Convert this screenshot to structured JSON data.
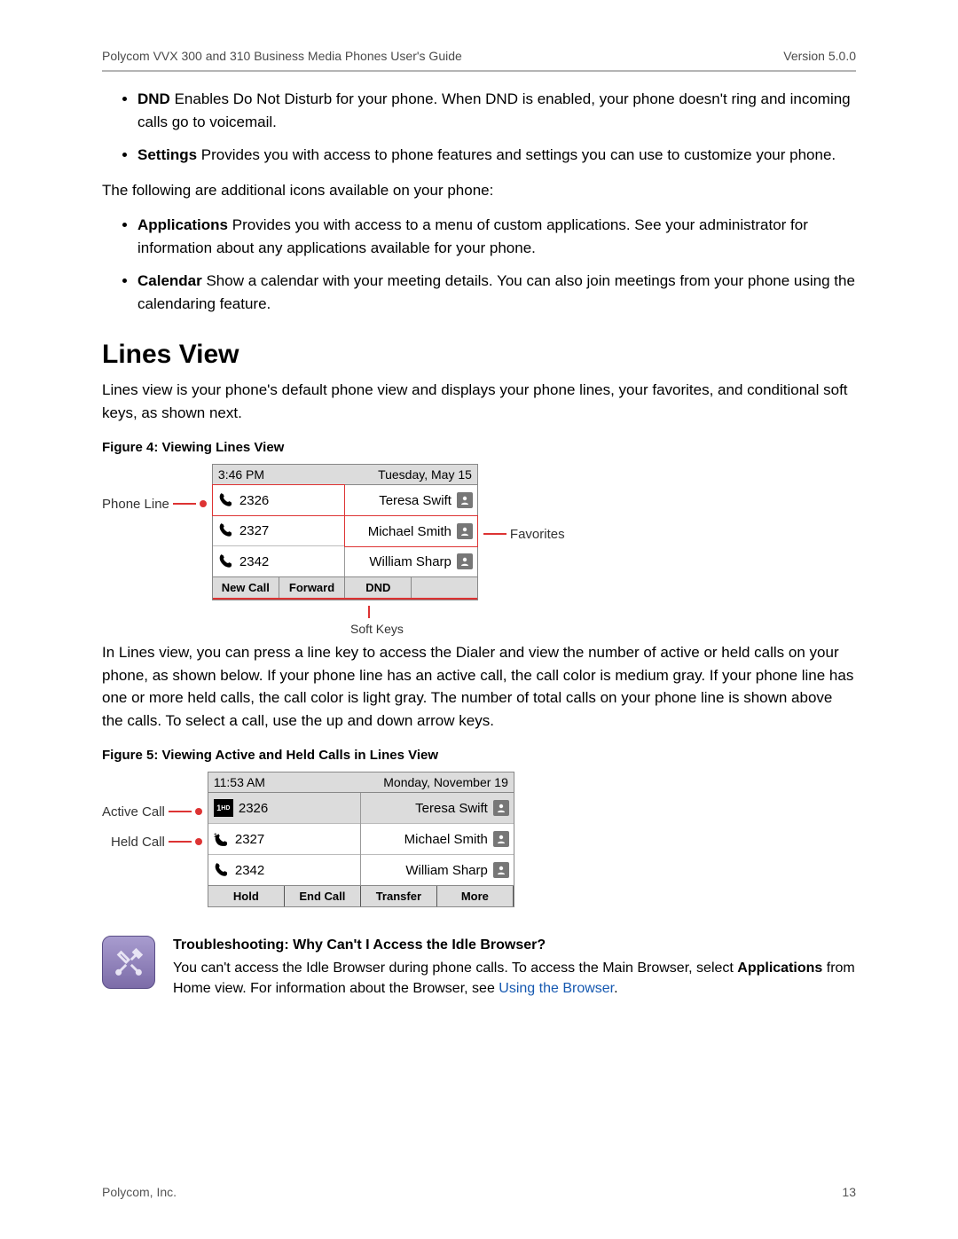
{
  "header": {
    "doc_title": "Polycom VVX 300 and 310 Business Media Phones User's Guide",
    "version": "Version 5.0.0"
  },
  "intro_bullets": [
    {
      "term": "DND",
      "desc": "   Enables Do Not Disturb for your phone. When DND is enabled, your phone doesn't ring and incoming calls go to voicemail."
    },
    {
      "term": "Settings",
      "desc": "   Provides you with access to phone features and settings you can use to customize your phone."
    }
  ],
  "mid_para": "The following are additional icons available on your phone:",
  "mid_bullets": [
    {
      "term": "Applications",
      "desc": "   Provides you with access to a menu of custom applications. See your administrator for information about any applications available for your phone."
    },
    {
      "term": "Calendar",
      "desc": "   Show a calendar with your meeting details. You can also join meetings from your phone using the calendaring feature."
    }
  ],
  "section_title": "Lines View",
  "section_para": "Lines view is your phone's default phone view and displays your phone lines, your favorites, and conditional soft keys, as shown next.",
  "fig1": {
    "caption": "Figure 4: Viewing Lines View",
    "labels": {
      "phone_line": "Phone Line",
      "favorites": "Favorites",
      "soft_keys": "Soft Keys"
    },
    "status": {
      "time": "3:46 PM",
      "date": "Tuesday, May 15"
    },
    "lines": [
      "2326",
      "2327",
      "2342"
    ],
    "contacts": [
      "Teresa Swift",
      "Michael Smith",
      "William Sharp"
    ],
    "softkeys": [
      "New Call",
      "Forward",
      "DND",
      ""
    ]
  },
  "para2": "In Lines view, you can press a line key to access the Dialer and view the number of active or held calls on your phone, as shown below. If your phone line has an active call, the call color is medium gray. If your phone line has one or more held calls, the call color is light gray. The number of total calls on your phone line is shown above the calls. To select a call, use the up and down arrow keys.",
  "fig2": {
    "caption": "Figure 5: Viewing Active and Held Calls in Lines View",
    "labels": {
      "active_call": "Active Call",
      "held_call": "Held Call"
    },
    "status": {
      "time": "11:53 AM",
      "date": "Monday, November 19"
    },
    "lines": [
      "2326",
      "2327",
      "2342"
    ],
    "contacts": [
      "Teresa Swift",
      "Michael Smith",
      "William Sharp"
    ],
    "softkeys": [
      "Hold",
      "End Call",
      "Transfer",
      "More"
    ]
  },
  "note": {
    "title": "Troubleshooting: Why Can't I Access the Idle Browser?",
    "body_pre": "You can't access the Idle Browser during phone calls. To access the Main Browser, select ",
    "body_bold": "Applications",
    "body_mid": " from Home view. For information about the Browser, see ",
    "link_text": "Using the Browser",
    "body_post": "."
  },
  "footer": {
    "org": "Polycom, Inc.",
    "page": "13"
  }
}
